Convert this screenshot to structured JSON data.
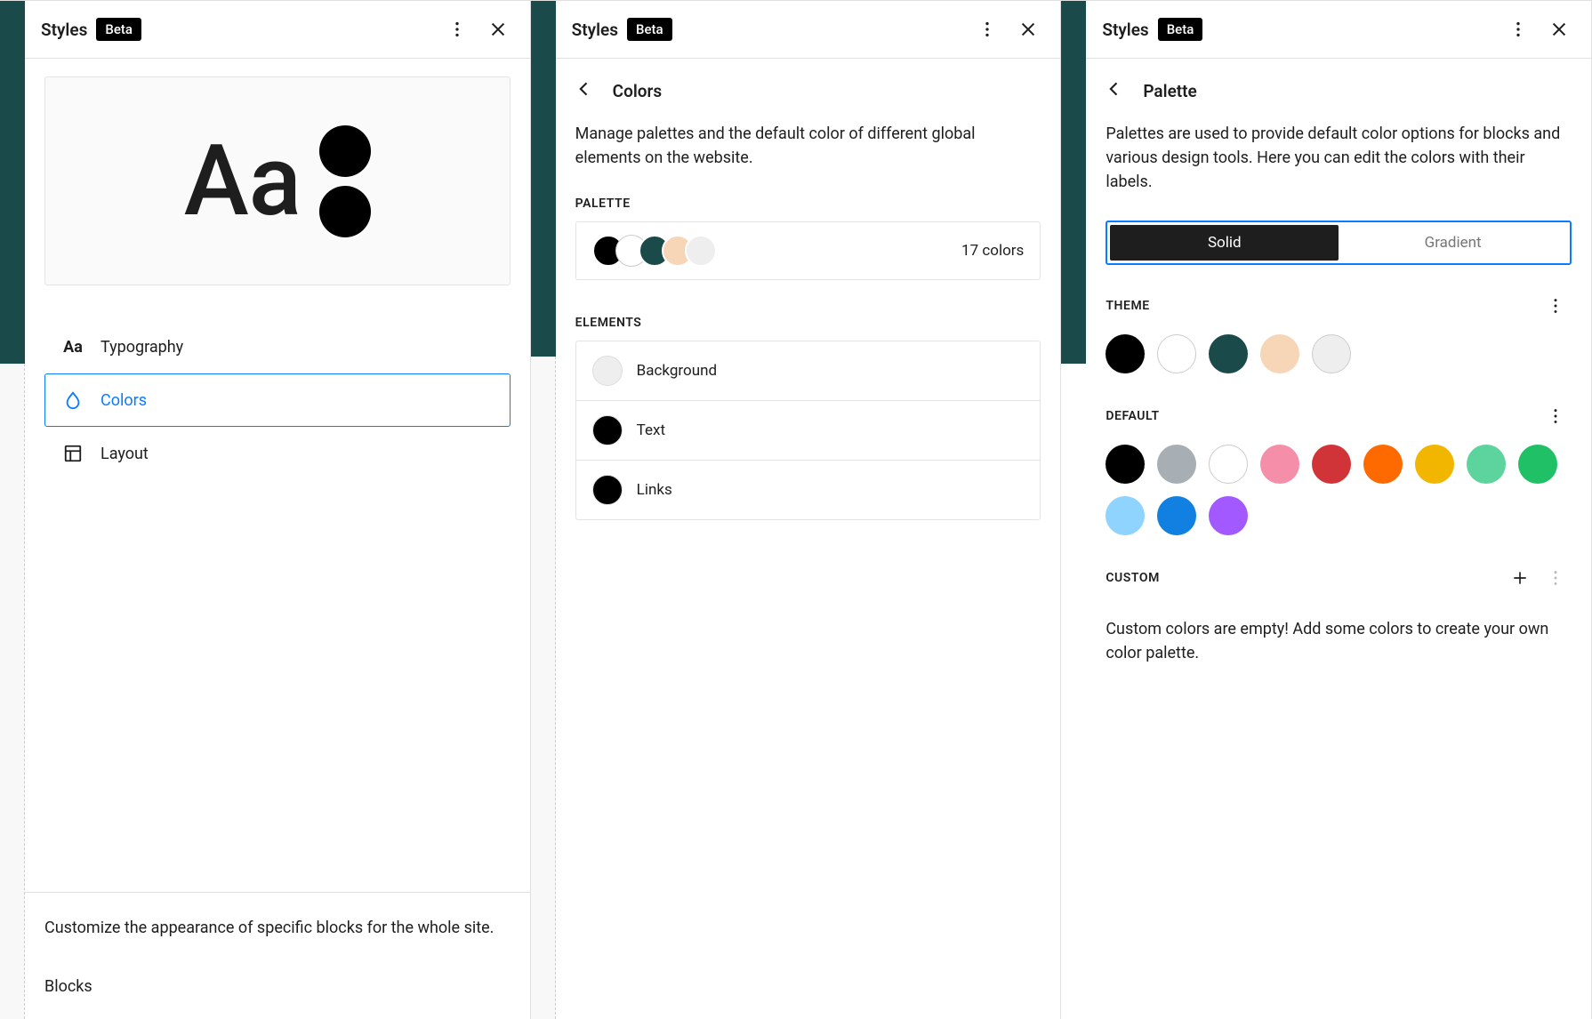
{
  "header": {
    "title": "Styles",
    "badge": "Beta"
  },
  "panel1": {
    "preview_text": "Aa",
    "nav": {
      "typography": "Typography",
      "colors": "Colors",
      "layout": "Layout"
    },
    "footer": {
      "desc": "Customize the appearance of specific blocks for the whole site.",
      "blocks": "Blocks"
    }
  },
  "panel2": {
    "title": "Colors",
    "desc": "Manage palettes and the default color of different global elements on the website.",
    "palette_label": "PALETTE",
    "palette_count": "17 colors",
    "palette_swatches": [
      "#000000",
      "#ffffff",
      "#1a4a4a",
      "#f7d6b8",
      "#eeeeee"
    ],
    "elements_label": "ELEMENTS",
    "elements": {
      "background": {
        "label": "Background",
        "color": "#eeeeee"
      },
      "text": {
        "label": "Text",
        "color": "#000000"
      },
      "links": {
        "label": "Links",
        "color": "#000000"
      }
    }
  },
  "panel3": {
    "title": "Palette",
    "desc": "Palettes are used to provide default color options for blocks and various design tools. Here you can edit the colors with their labels.",
    "tabs": {
      "solid": "Solid",
      "gradient": "Gradient"
    },
    "theme": {
      "label": "THEME",
      "colors": [
        "#000000",
        "#ffffff",
        "#1a4a4a",
        "#f7d6b8",
        "#eeeeee"
      ]
    },
    "default": {
      "label": "DEFAULT",
      "colors": [
        "#000000",
        "#a7aeb4",
        "#ffffff",
        "#f58ea8",
        "#d13438",
        "#ff6a00",
        "#f2b600",
        "#5dd39e",
        "#1fc066",
        "#8fd3ff",
        "#1180e0",
        "#a259ff"
      ]
    },
    "custom": {
      "label": "CUSTOM",
      "desc": "Custom colors are empty! Add some colors to create your own color palette."
    }
  }
}
